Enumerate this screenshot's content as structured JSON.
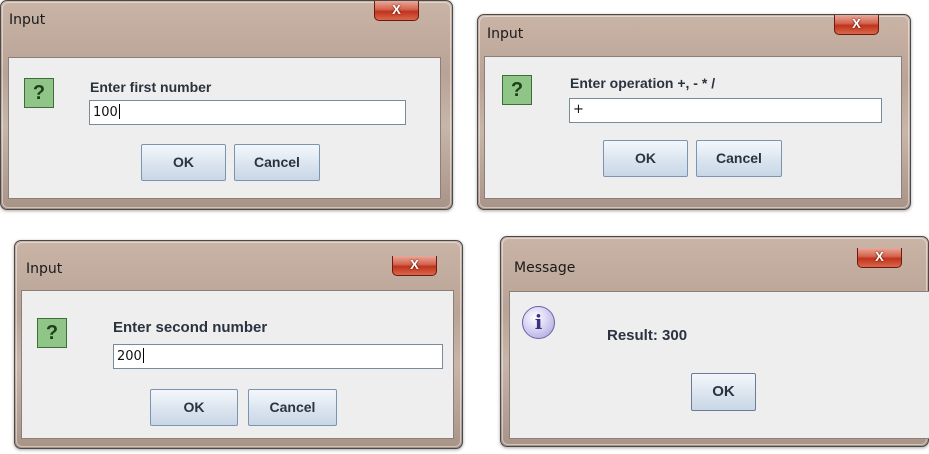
{
  "dialogs": {
    "first": {
      "title": "Input",
      "close_label": "X",
      "icon": "question-icon",
      "icon_glyph": "?",
      "prompt": "Enter first number",
      "input_value": "100",
      "ok_label": "OK",
      "cancel_label": "Cancel"
    },
    "operation": {
      "title": "Input",
      "close_label": "X",
      "icon": "question-icon",
      "icon_glyph": "?",
      "prompt": "Enter operation +, - * /",
      "input_value": "+",
      "ok_label": "OK",
      "cancel_label": "Cancel"
    },
    "second": {
      "title": "Input",
      "close_label": "X",
      "icon": "question-icon",
      "icon_glyph": "?",
      "prompt": "Enter second number",
      "input_value": "200",
      "ok_label": "OK",
      "cancel_label": "Cancel"
    },
    "message": {
      "title": "Message",
      "close_label": "X",
      "icon": "info-icon",
      "icon_glyph": "i",
      "text": "Result: 300",
      "ok_label": "OK"
    }
  },
  "colors": {
    "close_button": "#c0331c",
    "dialog_body": "#eeeeee",
    "question_icon": "#8fc687",
    "info_icon": "#a49dd8",
    "button": "#dde6f0"
  }
}
